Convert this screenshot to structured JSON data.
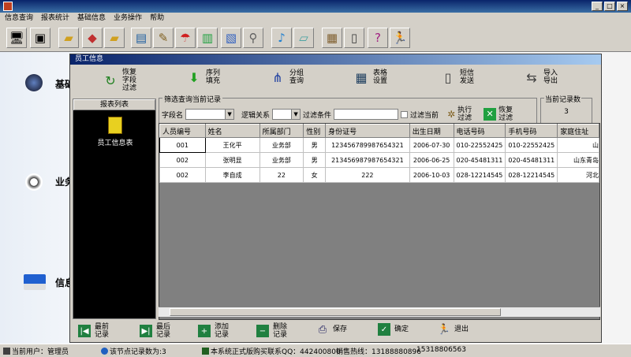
{
  "menu": [
    "信息查询",
    "报表统计",
    "基础信息",
    "业务操作",
    "帮助"
  ],
  "toolbar_icons": [
    "computer-icon",
    "monitor-icon",
    "folder-icon",
    "colors-icon",
    "folder-icon",
    "notebook-icon",
    "note-edit-icon",
    "umbrella-icon",
    "book-icon",
    "search-doc-icon",
    "magnifier-icon",
    "bell-icon",
    "notepad-icon",
    "picture-icon",
    "pda-icon",
    "help-book-icon",
    "running-man-icon"
  ],
  "sidebar": {
    "items": [
      {
        "label": "基础"
      },
      {
        "label": "业务"
      },
      {
        "label": "信息"
      }
    ]
  },
  "dialog": {
    "title": "员工信息",
    "tools": [
      {
        "label": "恢复字段过滤",
        "icon": "refresh-icon"
      },
      {
        "label": "序列填充",
        "icon": "down-arrow-icon"
      },
      {
        "label": "分组查询",
        "icon": "hierarchy-icon"
      },
      {
        "label": "表格设置",
        "icon": "table-icon"
      },
      {
        "label": "短信发送",
        "icon": "phone-icon"
      },
      {
        "label": "导入导出",
        "icon": "import-export-icon"
      }
    ],
    "left_panel": {
      "header": "报表列表",
      "item": "员工信息表"
    },
    "filter": {
      "title": "筛选查询当前记录",
      "field_label": "字段名",
      "logic_label": "逻辑关系",
      "condition_label": "过滤条件",
      "filter_current_label": "过滤当前",
      "execute_label": "执行过滤",
      "restore_label": "恢复过滤"
    },
    "record_count": {
      "label": "当前记录数",
      "value": "3"
    },
    "table": {
      "headers": [
        "人员编号",
        "姓名",
        "所属部门",
        "性别",
        "身份证号",
        "出生日期",
        "电话号码",
        "手机号码",
        "家庭住址"
      ],
      "rows": [
        [
          "001",
          "王化平",
          "业务部",
          "男",
          "123456789987654321",
          "2006-07-30",
          "010-22552425",
          "010-22552425",
          "山"
        ],
        [
          "002",
          "张明显",
          "业务部",
          "男",
          "213456987987654321",
          "2006-06-25",
          "020-45481311",
          "020-45481311",
          "山东青岛"
        ],
        [
          "002",
          "李自成",
          "22",
          "女",
          "222",
          "2006-10-03",
          "028-12214545",
          "028-12214545",
          "河北"
        ]
      ]
    },
    "bottom_tools": [
      {
        "label": "最前记录",
        "icon": "first-record-icon"
      },
      {
        "label": "最后记录",
        "icon": "last-record-icon"
      },
      {
        "label": "添加记录",
        "icon": "add-icon"
      },
      {
        "label": "删除记录",
        "icon": "delete-icon"
      },
      {
        "label": "保存",
        "icon": "printer-icon"
      },
      {
        "label": "确定",
        "icon": "check-icon"
      },
      {
        "label": "退出",
        "icon": "running-man-icon"
      }
    ]
  },
  "status": {
    "user": "当前用户：管理员",
    "records": "该节点记录数为:3",
    "qq": "本系统正式版购买联系QQ：442400800",
    "hotline": "销售热线：13188880896",
    "phone2": "15318806563"
  },
  "colors": {
    "title_bar": "#0a246a",
    "face": "#d4d0c8",
    "panel_black": "#000000",
    "grid_empty": "#808080"
  }
}
